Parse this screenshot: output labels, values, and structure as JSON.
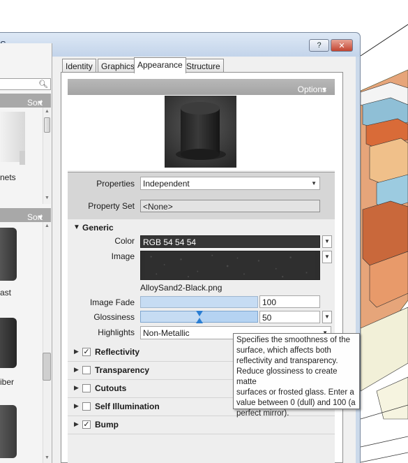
{
  "window": {
    "title": "S",
    "help_label": "?",
    "close_label": "✕"
  },
  "browser": {
    "search_placeholder": "",
    "sort1": "Sort",
    "sort2": "Sort",
    "items": [
      {
        "label": "nets"
      },
      {
        "label": "ast"
      },
      {
        "label": "iber"
      }
    ]
  },
  "tabs": [
    {
      "label": "Identity"
    },
    {
      "label": "Graphics"
    },
    {
      "label": "Appearance"
    },
    {
      "label": "Structure"
    }
  ],
  "asset": {
    "options_label": "Options",
    "properties_label": "Properties",
    "properties_value": "Independent",
    "property_set_label": "Property Set",
    "property_set_value": "<None>"
  },
  "generic": {
    "header": "Generic",
    "color_label": "Color",
    "color_value": "RGB 54 54 54",
    "image_label": "Image",
    "image_file": "AlloySand2-Black.png",
    "image_fade_label": "Image Fade",
    "image_fade_value": "100",
    "image_fade_level": 100,
    "glossiness_label": "Glossiness",
    "glossiness_value": "50",
    "glossiness_level": 50,
    "highlights_label": "Highlights",
    "highlights_value": "Non-Metallic"
  },
  "sections": [
    {
      "label": "Reflectivity",
      "checked": true
    },
    {
      "label": "Transparency",
      "checked": false
    },
    {
      "label": "Cutouts",
      "checked": false
    },
    {
      "label": "Self Illumination",
      "checked": false
    },
    {
      "label": "Bump",
      "checked": true
    }
  ],
  "tooltip": {
    "text": "Specifies the smoothness of the\nsurface, which affects both\nreflectivity and transparency.\nReduce glossiness to create matte\nsurfaces or frosted glass. Enter a\nvalue between 0 (dull) and 100 (a\nperfect mirror)."
  },
  "colors": {
    "accent": "#2a7ed3",
    "close": "#c24430",
    "header_gray": "#a8a8a8"
  }
}
